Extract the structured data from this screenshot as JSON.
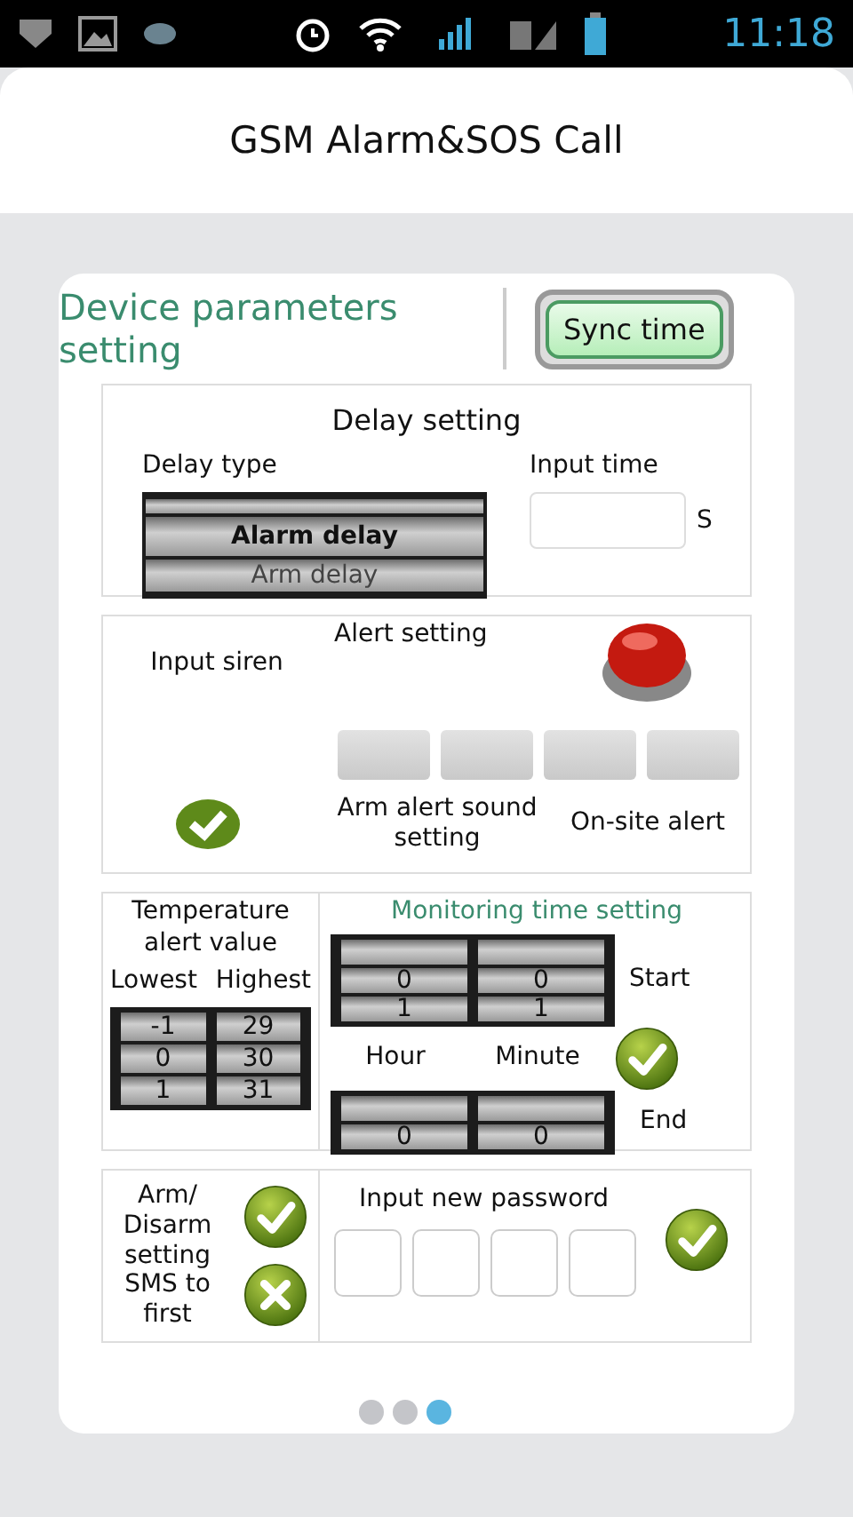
{
  "status_bar": {
    "time": "11:18"
  },
  "header": {
    "title": "GSM Alarm&SOS Call"
  },
  "card": {
    "title": "Device parameters setting",
    "sync_button": "Sync time"
  },
  "delay_setting": {
    "title": "Delay setting",
    "type_label": "Delay type",
    "type_options": [
      {
        "label": "Alarm delay",
        "selected": true
      },
      {
        "label": "Arm delay",
        "selected": false
      }
    ],
    "time_label": "Input time",
    "time_unit": "S"
  },
  "alert_setting": {
    "title": "Alert setting",
    "siren_label": "Input siren",
    "siren_checked": true,
    "sound_label": "Arm alert sound setting",
    "onsite_label": "On-site alert"
  },
  "temperature": {
    "title": "Temperature alert value",
    "low_label": "Lowest",
    "high_label": "Highest",
    "low_values": [
      "-1",
      "0",
      "1"
    ],
    "high_values": [
      "29",
      "30",
      "31"
    ]
  },
  "monitoring": {
    "title": "Monitoring time setting",
    "start_label": "Start",
    "end_label": "End",
    "hour_label": "Hour",
    "minute_label": "Minute",
    "start_hour": [
      "0",
      "1"
    ],
    "start_minute": [
      "0",
      "1"
    ],
    "end_hour": [
      "0"
    ],
    "end_minute": [
      "0"
    ]
  },
  "arm_sms": {
    "label": "Arm/ Disarm setting SMS to first"
  },
  "password": {
    "label": "Input new password"
  },
  "pager": [
    {
      "selected": false
    },
    {
      "selected": false
    },
    {
      "selected": true
    }
  ]
}
